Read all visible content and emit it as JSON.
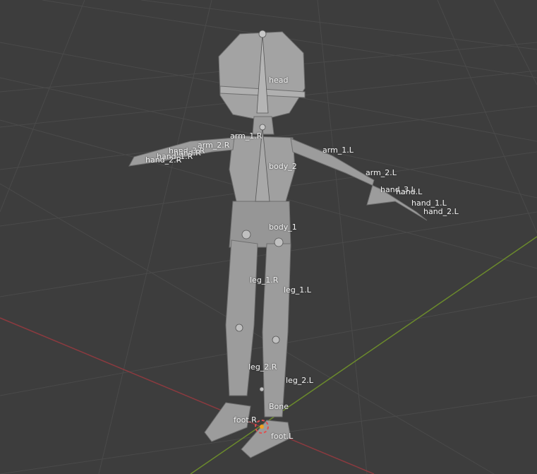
{
  "viewport": {
    "colors": {
      "background": "#3d3d3d",
      "grid": "#494949",
      "x_axis": "#8b3a3f",
      "y_axis": "#6b8a2c",
      "mesh": "#9c9c9c"
    },
    "bones": {
      "head": "head",
      "arm_1_R": "arm_1.R",
      "arm_2_R": "arm_2.R",
      "hand_3_R": "hand_3.R",
      "hand_R": "hand.R",
      "hand_1_R": "hand_1.R",
      "hand_2_R": "hand_2.R",
      "arm_1_L": "arm_1.L",
      "arm_2_L": "arm_2.L",
      "hand_3_L": "hand_3.L",
      "hand_L": "hand.L",
      "hand_1_L": "hand_1.L",
      "hand_2_L": "hand_2.L",
      "body_2": "body_2",
      "body_1": "body_1",
      "leg_1_R": "leg_1.R",
      "leg_1_L": "leg_1.L",
      "leg_2_R": "leg_2.R",
      "leg_2_L": "leg_2.L",
      "bone": "Bone",
      "foot_R": "foot.R",
      "foot_L": "foot.L"
    }
  }
}
